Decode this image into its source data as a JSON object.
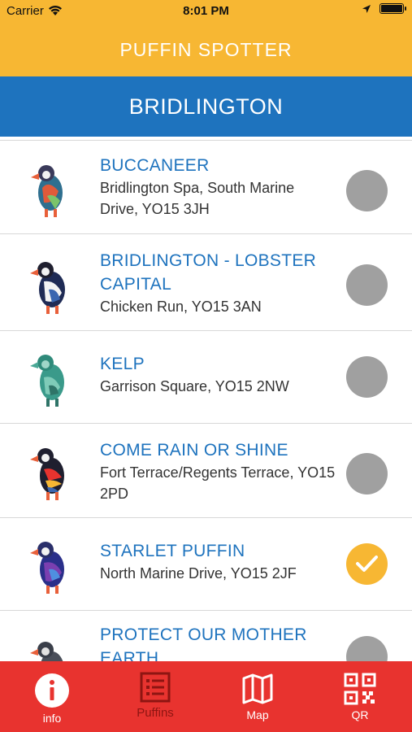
{
  "status_bar": {
    "carrier": "Carrier",
    "time": "8:01 PM"
  },
  "header": {
    "title": "PUFFIN SPOTTER"
  },
  "section": {
    "title": "BRIDLINGTON"
  },
  "puffins": [
    {
      "name": "BUCCANEER",
      "address": "Bridlington Spa, South Marine Drive, YO15 3JH",
      "spotted": false
    },
    {
      "name": "BRIDLINGTON - LOBSTER CAPITAL",
      "address": "Chicken Run, YO15 3AN",
      "spotted": false
    },
    {
      "name": "KELP",
      "address": "Garrison Square, YO15 2NW",
      "spotted": false
    },
    {
      "name": "COME RAIN OR SHINE",
      "address": "Fort Terrace/Regents Terrace, YO15 2PD",
      "spotted": false
    },
    {
      "name": "STARLET PUFFIN",
      "address": "North Marine Drive, YO15 2JF",
      "spotted": true
    },
    {
      "name": "PROTECT OUR MOTHER EARTH",
      "address": "",
      "spotted": false
    }
  ],
  "tabs": [
    {
      "label": "info",
      "icon": "info-icon",
      "active": false
    },
    {
      "label": "Puffins",
      "icon": "list-icon",
      "active": true
    },
    {
      "label": "Map",
      "icon": "map-icon",
      "active": false
    },
    {
      "label": "QR",
      "icon": "qr-code-icon",
      "active": false
    }
  ],
  "colors": {
    "header": "#f7b733",
    "section": "#1e73be",
    "tab_bar": "#e8332f",
    "spotted": "#f7b733",
    "unspotted": "#a0a0a0"
  }
}
